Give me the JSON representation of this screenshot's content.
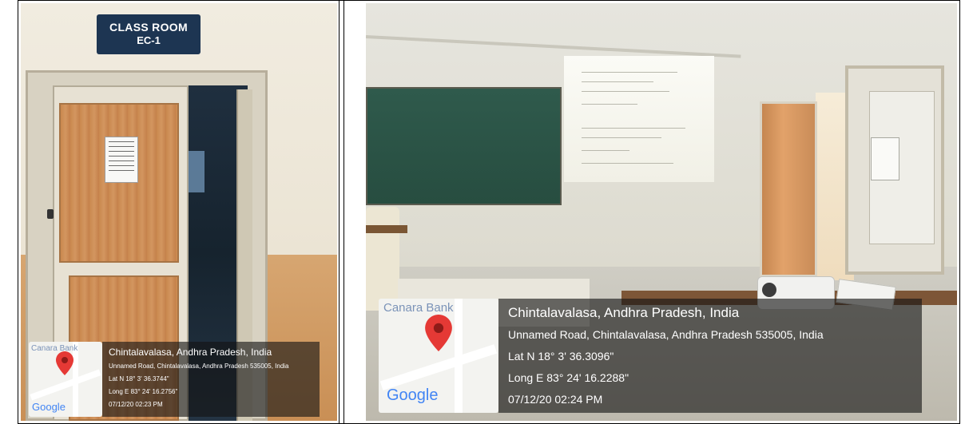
{
  "left_photo": {
    "sign": {
      "line1": "CLASS ROOM",
      "line2": "EC-1"
    },
    "gps": {
      "map_label": "Canara Bank",
      "map_logo": "Google",
      "place": "Chintalavalasa, Andhra Pradesh, India",
      "address": "Unnamed Road, Chintalavalasa, Andhra Pradesh 535005, India",
      "lat": "Lat N 18° 3' 36.3744\"",
      "long": "Long E 83° 24' 16.2756\"",
      "datetime": "07/12/20 02:23 PM"
    }
  },
  "right_photo": {
    "gps": {
      "map_label": "Canara Bank",
      "map_logo": "Google",
      "place": "Chintalavalasa, Andhra Pradesh, India",
      "address": "Unnamed Road, Chintalavalasa, Andhra Pradesh 535005, India",
      "lat": "Lat N 18° 3' 36.3096\"",
      "long": "Long E 83° 24' 16.2288\"",
      "datetime": "07/12/20 02:24 PM"
    }
  },
  "colors": {
    "pin": "#e53935",
    "overlay": "#141414",
    "sign_bg": "#1d3552",
    "google_blue": "#4285f4",
    "google_red": "#ea4335",
    "google_yellow": "#fbbc05",
    "google_green": "#34a853"
  }
}
